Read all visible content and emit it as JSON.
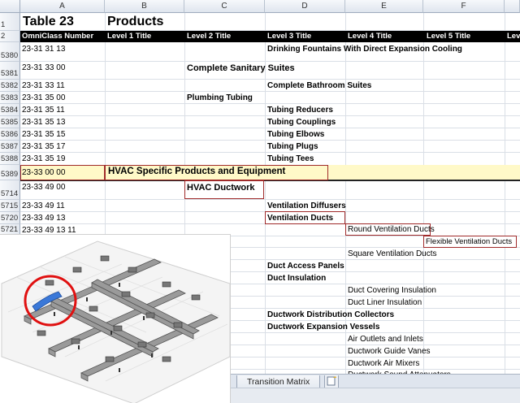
{
  "columns": [
    "A",
    "B",
    "C",
    "D",
    "E",
    "F"
  ],
  "rows": {
    "r1": "1",
    "r2": "2",
    "r5380": "5380",
    "r5381": "5381",
    "r5382": "5382",
    "r5383": "5383",
    "r5384": "5384",
    "r5385": "5385",
    "r5386": "5386",
    "r5387": "5387",
    "r5388": "5388",
    "r5389": "5389",
    "r5714": "5714",
    "r5715": "5715",
    "r5720": "5720",
    "r5721": "5721"
  },
  "title": {
    "table": "Table 23",
    "name": "Products"
  },
  "headers": [
    "OmniClass Number",
    "Level 1 Title",
    "Level 2 Title",
    "Level 3 Title",
    "Level 4 Title",
    "Level 5 Title",
    "Leve"
  ],
  "cells": {
    "a5380": "23-31 31 13",
    "d5380": "Drinking Fountains With Direct Expansion Cooling",
    "a5381": "23-31 33 00",
    "c5381": "Complete Sanitary Suites",
    "a5382": "23-31 33 11",
    "d5382": "Complete Bathroom Suites",
    "a5383": "23-31 35 00",
    "c5383": "Plumbing Tubing",
    "a5384": "23-31 35 11",
    "d5384": "Tubing Reducers",
    "a5385": "23-31 35 13",
    "d5385": "Tubing Couplings",
    "a5386": "23-31 35 15",
    "d5386": "Tubing Elbows",
    "a5387": "23-31 35 17",
    "d5387": "Tubing Plugs",
    "a5388": "23-31 35 19",
    "d5388": "Tubing Tees",
    "a5389": "23-33 00 00",
    "b5389": "HVAC Specific Products and Equipment",
    "a5714": "23-33 49 00",
    "c5714": "HVAC Ductwork",
    "a5715": "23-33 49 11",
    "d5715": "Ventilation Diffusers",
    "a5720": "23-33 49 13",
    "d5720": "Ventilation Ducts",
    "a5721": "23-33 49 13 11",
    "e5721": "Round Ventilation Ducts",
    "f_flex": "Flexible Ventilation Ducts",
    "e_square": "Square Ventilation Ducts",
    "d_access": "Duct Access Panels",
    "d_insul": "Duct Insulation",
    "e_cov": "Duct Covering Insulation",
    "e_liner": "Duct Liner Insulation",
    "d_dist": "Ductwork Distribution Collectors",
    "d_exp": "Ductwork Expansion Vessels",
    "e_outlets": "Air Outlets and Inlets",
    "e_vanes": "Ductwork Guide Vanes",
    "e_mixers": "Ductwork Air Mixers",
    "e_atten": "Ductwork Sound Attenuators"
  },
  "sheet_tab": "Transition Matrix",
  "colors": {
    "header_band": "#000000",
    "highlight_row": "#fff9c8",
    "callout_border": "#a02a2a",
    "callout_circle": "#e01010",
    "duct_highlight": "#3a78d8"
  }
}
